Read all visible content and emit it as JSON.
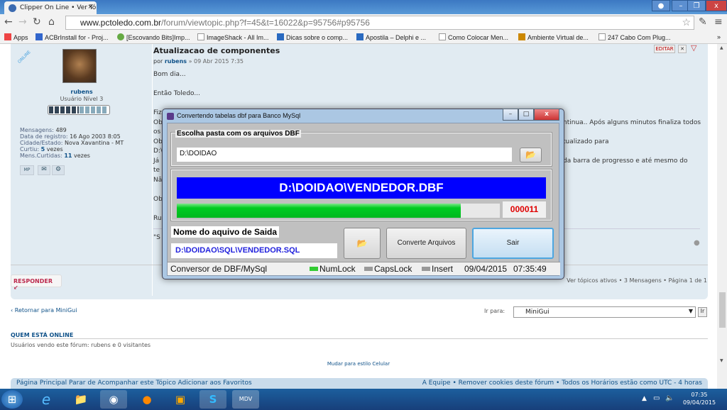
{
  "browser": {
    "tab_title": "Clipper On Line • Ver Tópi",
    "url_host": "www.pctoledo.com.br",
    "url_path": "/forum/viewtopic.php?f=45&t=16022&p=95756#p95756",
    "bookmarks": [
      "Apps",
      "ACBrInstall for - Proj...",
      "[Escovando Bits]Imp...",
      "ImageShack - All Im...",
      "Dicas sobre o comp...",
      "Apostila – Delphi e ...",
      "Como Colocar Men...",
      "Ambiente Virtual de...",
      "247 Cabo Com Plug..."
    ],
    "more": "»"
  },
  "post": {
    "online_badge": "ONLINE",
    "author": "rubens",
    "rank": "Usuário Nível 3",
    "stats": [
      {
        "label": "Mensagens:",
        "value": "489"
      },
      {
        "label": "Data de registro:",
        "value": "16 Ago 2003 8:05"
      },
      {
        "label": "Cidade/Estado:",
        "value": "Nova Xavantina - MT"
      },
      {
        "label": "Curtiu:",
        "value": "5",
        "suffix": "vezes"
      },
      {
        "label": "Mens.Curtidas:",
        "value": "11",
        "suffix": "vezes"
      }
    ],
    "pm_label": "MP",
    "title": "Atualizacao de componentes",
    "meta_by": "por",
    "meta_author": "rubens",
    "meta_date": "» 09 Abr 2015 7:35",
    "edit_label": "EDITAR",
    "lines": [
      {
        "l": "Bom dia...",
        "r": ""
      },
      {
        "l": "Então Toledo...",
        "r": ""
      },
      {
        "l": "Fiz",
        "r": ""
      },
      {
        "l": "Ob",
        "r": "ntinua.. Após alguns minutos finaliza todos"
      },
      {
        "l": "os",
        "r": ""
      },
      {
        "l": "Ob",
        "r": "tualizado para"
      },
      {
        "l": "D:\\",
        "r": ""
      },
      {
        "l": "Já",
        "r": "da barra de progresso e até mesmo do"
      },
      {
        "l": "te",
        "r": ""
      },
      {
        "l": "Nã",
        "r": ""
      },
      {
        "l": "Ob",
        "r": ""
      },
      {
        "l": "Ru",
        "r": ""
      },
      {
        "l": "\"S",
        "r": ""
      }
    ]
  },
  "forum": {
    "reply_label": "RESPONDER",
    "pagination": "Ver tópicos ativos • 3 Mensagens • Página 1 de 1",
    "back_link": "‹ Retornar para MiniGui",
    "goto_label": "Ir para:",
    "goto_value": "MiniGui",
    "goto_button": "Ir",
    "online_heading": "QUEM ESTÁ ONLINE",
    "online_text": "Usuários vendo este fórum: rubens e 0 visitantes",
    "mobile_link": "Mudar para estilo Celular",
    "footer_left": "Página Principal  Parar de Acompanhar este Tópico  Adicionar aos Favoritos",
    "footer_right": "A Equipe • Remover cookies deste fórum • Todos os Horários estão como UTC - 4 horas"
  },
  "dialog": {
    "title": "Convertendo tabelas dbf para Banco MySql",
    "folder_group_label": "Escolha pasta com os arquivos DBF",
    "folder_value": "D:\\DOIDAO",
    "current_file": "D:\\DOIDAO\\VENDEDOR.DBF",
    "progress_percent": 88,
    "counter": "000011",
    "output_label": "Nome do aquivo de Saida",
    "output_value": "D:\\DOIDAO\\SQL\\VENDEDOR.SQL",
    "convert_button": "Converte Arquivos",
    "exit_button": "Sair",
    "status": {
      "app": "Conversor de DBF/MySql",
      "numlock": "NumLock",
      "capslock": "CapsLock",
      "insert": "Insert",
      "date": "09/04/2015",
      "time": "07:35:49"
    },
    "colors": {
      "file_bar": "#0000ff",
      "progress": "#00cc22",
      "counter": "#e00000"
    }
  },
  "taskbar": {
    "time": "07:35",
    "date": "09/04/2015",
    "mdv_label": "MDV"
  }
}
